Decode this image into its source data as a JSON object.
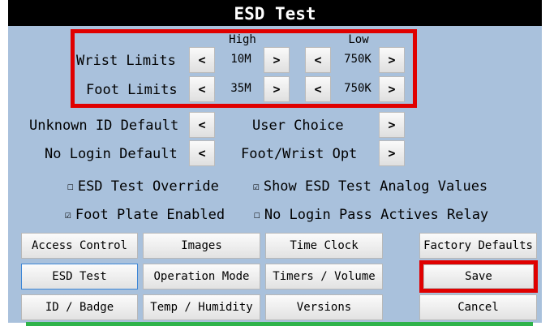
{
  "window": {
    "title": "ESD Test"
  },
  "limits": {
    "high_header": "High",
    "low_header": "Low",
    "rows": [
      {
        "label": "Wrist Limits",
        "high": "10M",
        "low": "750K"
      },
      {
        "label": "Foot Limits",
        "high": "35M",
        "low": "750K"
      }
    ],
    "dec_symbol": "<",
    "inc_symbol": ">"
  },
  "selectors": [
    {
      "label": "Unknown ID Default",
      "value": "User Choice"
    },
    {
      "label": "No Login Default",
      "value": "Foot/Wrist Opt"
    }
  ],
  "checkboxes": [
    {
      "label": "ESD Test Override",
      "checked": false
    },
    {
      "label": "Show ESD Test Analog Values",
      "checked": true
    },
    {
      "label": "Foot Plate Enabled",
      "checked": true
    },
    {
      "label": "No Login Pass Actives Relay",
      "checked": false
    }
  ],
  "checkbox_glyphs": {
    "checked": "☑",
    "unchecked": "☐"
  },
  "nav_buttons": {
    "access_control": "Access Control",
    "images": "Images",
    "time_clock": "Time Clock",
    "factory_defaults": "Factory Defaults",
    "esd_test": "ESD Test",
    "operation_mode": "Operation Mode",
    "timers_volume": "Timers / Volume",
    "save": "Save",
    "id_badge": "ID / Badge",
    "temp_humidity": "Temp / Humidity",
    "versions": "Versions",
    "cancel": "Cancel"
  },
  "colors": {
    "panel_background": "#a9c1dc",
    "title_background": "#000000",
    "highlight_red": "#e00000",
    "active_border": "#3d86d6",
    "status_green": "#2fb34a"
  }
}
